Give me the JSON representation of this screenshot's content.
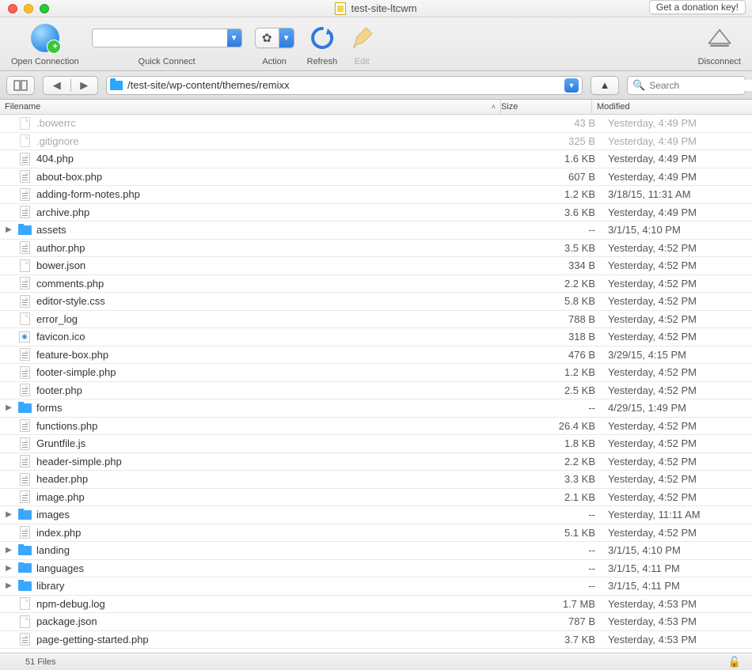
{
  "window": {
    "title": "test-site-ltcwm",
    "donation_button": "Get a donation key!"
  },
  "toolbar": {
    "open_connection": "Open Connection",
    "quick_connect": "Quick Connect",
    "quick_connect_value": "",
    "action": "Action",
    "refresh": "Refresh",
    "edit": "Edit",
    "disconnect": "Disconnect"
  },
  "pathbar": {
    "path": "/test-site/wp-content/themes/remixx",
    "search_placeholder": "Search"
  },
  "columns": {
    "filename": "Filename",
    "size": "Size",
    "modified": "Modified"
  },
  "files": [
    {
      "name": ".bowerrc",
      "size": "43 B",
      "modified": "Yesterday, 4:49 PM",
      "type": "blank",
      "dim": true
    },
    {
      "name": ".gitignore",
      "size": "325 B",
      "modified": "Yesterday, 4:49 PM",
      "type": "blank",
      "dim": true
    },
    {
      "name": "404.php",
      "size": "1.6 KB",
      "modified": "Yesterday, 4:49 PM",
      "type": "file"
    },
    {
      "name": "about-box.php",
      "size": "607 B",
      "modified": "Yesterday, 4:49 PM",
      "type": "file"
    },
    {
      "name": "adding-form-notes.php",
      "size": "1.2 KB",
      "modified": "3/18/15, 11:31 AM",
      "type": "file"
    },
    {
      "name": "archive.php",
      "size": "3.6 KB",
      "modified": "Yesterday, 4:49 PM",
      "type": "file"
    },
    {
      "name": "assets",
      "size": "--",
      "modified": "3/1/15, 4:10 PM",
      "type": "folder"
    },
    {
      "name": "author.php",
      "size": "3.5 KB",
      "modified": "Yesterday, 4:52 PM",
      "type": "file"
    },
    {
      "name": "bower.json",
      "size": "334 B",
      "modified": "Yesterday, 4:52 PM",
      "type": "blank"
    },
    {
      "name": "comments.php",
      "size": "2.2 KB",
      "modified": "Yesterday, 4:52 PM",
      "type": "file"
    },
    {
      "name": "editor-style.css",
      "size": "5.8 KB",
      "modified": "Yesterday, 4:52 PM",
      "type": "file"
    },
    {
      "name": "error_log",
      "size": "788 B",
      "modified": "Yesterday, 4:52 PM",
      "type": "blank"
    },
    {
      "name": "favicon.ico",
      "size": "318 B",
      "modified": "Yesterday, 4:52 PM",
      "type": "fav"
    },
    {
      "name": "feature-box.php",
      "size": "476 B",
      "modified": "3/29/15, 4:15 PM",
      "type": "file"
    },
    {
      "name": "footer-simple.php",
      "size": "1.2 KB",
      "modified": "Yesterday, 4:52 PM",
      "type": "file"
    },
    {
      "name": "footer.php",
      "size": "2.5 KB",
      "modified": "Yesterday, 4:52 PM",
      "type": "file"
    },
    {
      "name": "forms",
      "size": "--",
      "modified": "4/29/15, 1:49 PM",
      "type": "folder"
    },
    {
      "name": "functions.php",
      "size": "26.4 KB",
      "modified": "Yesterday, 4:52 PM",
      "type": "file"
    },
    {
      "name": "Gruntfile.js",
      "size": "1.8 KB",
      "modified": "Yesterday, 4:52 PM",
      "type": "file"
    },
    {
      "name": "header-simple.php",
      "size": "2.2 KB",
      "modified": "Yesterday, 4:52 PM",
      "type": "file"
    },
    {
      "name": "header.php",
      "size": "3.3 KB",
      "modified": "Yesterday, 4:52 PM",
      "type": "file"
    },
    {
      "name": "image.php",
      "size": "2.1 KB",
      "modified": "Yesterday, 4:52 PM",
      "type": "file"
    },
    {
      "name": "images",
      "size": "--",
      "modified": "Yesterday, 11:11 AM",
      "type": "folder"
    },
    {
      "name": "index.php",
      "size": "5.1 KB",
      "modified": "Yesterday, 4:52 PM",
      "type": "file"
    },
    {
      "name": "landing",
      "size": "--",
      "modified": "3/1/15, 4:10 PM",
      "type": "folder"
    },
    {
      "name": "languages",
      "size": "--",
      "modified": "3/1/15, 4:11 PM",
      "type": "folder"
    },
    {
      "name": "library",
      "size": "--",
      "modified": "3/1/15, 4:11 PM",
      "type": "folder"
    },
    {
      "name": "npm-debug.log",
      "size": "1.7 MB",
      "modified": "Yesterday, 4:53 PM",
      "type": "blank"
    },
    {
      "name": "package.json",
      "size": "787 B",
      "modified": "Yesterday, 4:53 PM",
      "type": "blank"
    },
    {
      "name": "page-getting-started.php",
      "size": "3.7 KB",
      "modified": "Yesterday, 4:53 PM",
      "type": "file"
    }
  ],
  "status": {
    "count": "51 Files"
  }
}
